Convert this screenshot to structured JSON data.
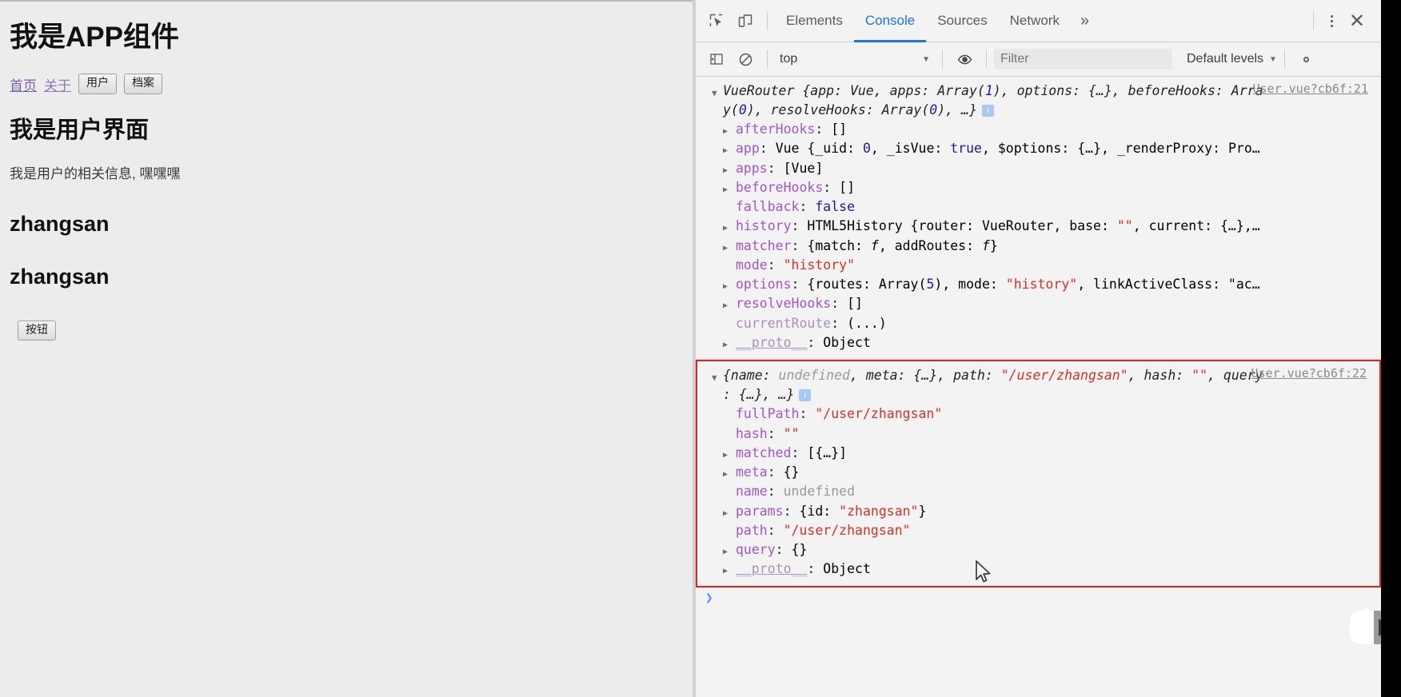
{
  "page": {
    "app_title": "我是APP组件",
    "nav_links": [
      {
        "label": "首页",
        "name": "home"
      },
      {
        "label": "关于",
        "name": "about"
      }
    ],
    "nav_buttons": [
      {
        "label": "用户",
        "name": "user"
      },
      {
        "label": "档案",
        "name": "archive"
      }
    ],
    "section_title": "我是用户界面",
    "section_text": "我是用户的相关信息, 嘿嘿嘿",
    "username_1": "zhangsan",
    "username_2": "zhangsan",
    "action_button": "按钮"
  },
  "devtools": {
    "tabs": [
      {
        "label": "Elements",
        "active": false
      },
      {
        "label": "Console",
        "active": true
      },
      {
        "label": "Sources",
        "active": false
      },
      {
        "label": "Network",
        "active": false
      }
    ],
    "more_tabs_glyph": "»",
    "close_glyph": "✕",
    "accent_color": "#1a73e8",
    "console_bar": {
      "context": "top",
      "caret": "▼",
      "filter_placeholder": "Filter",
      "filter_value": "",
      "levels_label": "Default levels",
      "levels_caret": "▼"
    },
    "prompt_glyph": "❯",
    "messages": [
      {
        "source": "User.vue?cb6f:21",
        "highlighted": false,
        "preview": [
          {
            "t": "VueRouter {app: Vue, apps: Array(1), options: {…}, beforeHooks: Arra",
            "c": "cls"
          },
          {
            "t": "y(0), resolveHooks: Array(0), …}",
            "c": "cls"
          }
        ],
        "info_badge": "i",
        "props": [
          {
            "tri": "closed",
            "key": "afterHooks",
            "value": "[]",
            "vclass": "punc"
          },
          {
            "tri": "closed",
            "key": "app",
            "value": "Vue {_uid: 0, _isVue: true, $options: {…}, _renderProxy: Pro…",
            "vclass": "mixed-app"
          },
          {
            "tri": "closed",
            "key": "apps",
            "value": "[Vue]",
            "vclass": "punc"
          },
          {
            "tri": "closed",
            "key": "beforeHooks",
            "value": "[]",
            "vclass": "punc"
          },
          {
            "tri": "none",
            "key": "fallback",
            "value": "false",
            "vclass": "bool"
          },
          {
            "tri": "closed",
            "key": "history",
            "value": "HTML5History {router: VueRouter, base: \"\", current: {…},…",
            "vclass": "mixed-history"
          },
          {
            "tri": "closed",
            "key": "matcher",
            "value": "{match: f, addRoutes: f}",
            "vclass": "mixed-matcher"
          },
          {
            "tri": "none",
            "key": "mode",
            "value": "\"history\"",
            "vclass": "str"
          },
          {
            "tri": "closed",
            "key": "options",
            "value": "{routes: Array(5), mode: \"history\", linkActiveClass: \"ac…",
            "vclass": "mixed-options"
          },
          {
            "tri": "closed",
            "key": "resolveHooks",
            "value": "[]",
            "vclass": "punc"
          },
          {
            "tri": "none",
            "key": "currentRoute",
            "keyclass": "dim",
            "value": "(...)",
            "vclass": "punc"
          },
          {
            "tri": "closed",
            "key": "__proto__",
            "keyclass": "proto",
            "value": "Object",
            "vclass": "cls"
          }
        ]
      },
      {
        "source": "User.vue?cb6f:22",
        "highlighted": true,
        "highlight_color": "#e52020",
        "preview": [
          {
            "t": "{name: undefined, meta: {…}, path: \"/user/zhangsan\", hash: \"\", query",
            "c": "cls"
          },
          {
            "t": ": {…}, …}",
            "c": "cls"
          }
        ],
        "info_badge": "i",
        "props": [
          {
            "tri": "none",
            "key": "fullPath",
            "value": "\"/user/zhangsan\"",
            "vclass": "str"
          },
          {
            "tri": "none",
            "key": "hash",
            "value": "\"\"",
            "vclass": "str"
          },
          {
            "tri": "closed",
            "key": "matched",
            "value": "[{…}]",
            "vclass": "punc"
          },
          {
            "tri": "closed",
            "key": "meta",
            "value": "{}",
            "vclass": "punc"
          },
          {
            "tri": "none",
            "key": "name",
            "value": "undefined",
            "vclass": "undef"
          },
          {
            "tri": "closed",
            "key": "params",
            "value": "{id: \"zhangsan\"}",
            "vclass": "mixed-params"
          },
          {
            "tri": "none",
            "key": "path",
            "value": "\"/user/zhangsan\"",
            "vclass": "str"
          },
          {
            "tri": "closed",
            "key": "query",
            "value": "{}",
            "vclass": "punc"
          },
          {
            "tri": "closed",
            "key": "__proto__",
            "keyclass": "proto",
            "value": "Object",
            "vclass": "cls"
          }
        ]
      }
    ]
  },
  "icons": {
    "inspect": "inspect-element-icon",
    "device": "device-toolbar-icon",
    "sidebar": "console-sidebar-icon",
    "clear": "clear-console-icon",
    "eye": "live-expression-icon",
    "settings": "settings-gear-icon"
  }
}
